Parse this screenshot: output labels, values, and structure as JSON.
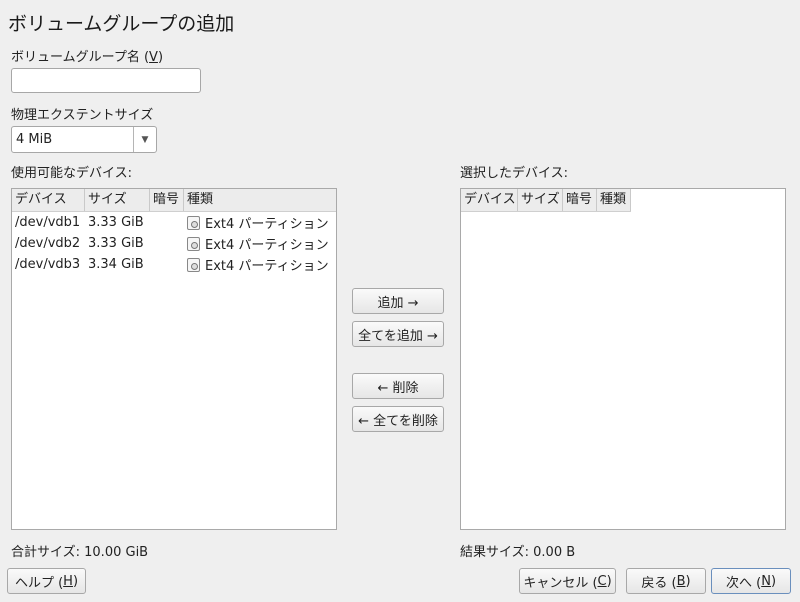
{
  "window": {
    "title": "ボリュームグループの追加"
  },
  "vg_name": {
    "label_text": "ボリュームグループ名 (",
    "mnemonic": "V",
    "label_close": ")",
    "value": ""
  },
  "extent": {
    "label": "物理エクステントサイズ",
    "selected": "4 MiB"
  },
  "available": {
    "label": "使用可能なデバイス:",
    "columns": [
      "デバイス",
      "サイズ",
      "暗号",
      "種類"
    ],
    "rows": [
      {
        "device": "/dev/vdb1",
        "size": "3.33 GiB",
        "encrypted": "",
        "type_icon": "partition-icon",
        "type": "Ext4 パーティション"
      },
      {
        "device": "/dev/vdb2",
        "size": "3.33 GiB",
        "encrypted": "",
        "type_icon": "partition-icon",
        "type": "Ext4 パーティション"
      },
      {
        "device": "/dev/vdb3",
        "size": "3.34 GiB",
        "encrypted": "",
        "type_icon": "partition-icon",
        "type": "Ext4 パーティション"
      }
    ],
    "total_label": "合計サイズ:",
    "total_value": "10.00 GiB"
  },
  "selected": {
    "label": "選択したデバイス:",
    "columns": [
      "デバイス",
      "サイズ",
      "暗号",
      "種類"
    ],
    "rows": [],
    "result_label": "結果サイズ:",
    "result_value": "0.00 B"
  },
  "transfer": {
    "add": "追加 →",
    "add_all": "全てを追加 →",
    "remove": "← 削除",
    "remove_all": "← 全てを削除"
  },
  "footer": {
    "help": {
      "text": "ヘルプ (",
      "mnemonic": "H",
      "close": ")"
    },
    "cancel": {
      "text": "キャンセル (",
      "mnemonic": "C",
      "close": ")"
    },
    "back": {
      "text": "戻る (",
      "mnemonic": "B",
      "close": ")"
    },
    "next": {
      "text": "次へ (",
      "mnemonic": "N",
      "close": ")"
    }
  }
}
